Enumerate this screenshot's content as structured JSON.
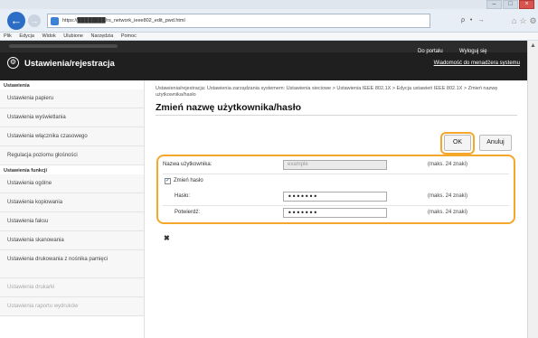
{
  "browser": {
    "url": "https://████████/rs_network_ieee802_edit_pwd.html",
    "url_tools": "ρ • →",
    "menu": [
      "Plik",
      "Edycja",
      "Widok",
      "Ulubione",
      "Narzędzia",
      "Pomoc"
    ]
  },
  "header": {
    "title": "Ustawienia/rejestracja",
    "portal_link": "Do portalu",
    "logout_link": "Wyloguj się",
    "admin_message_link": "Wiadomość do menadżera systemu"
  },
  "sidebar": {
    "section1": "Ustawienia",
    "items1": [
      "Ustawienia papieru",
      "Ustawienia wyświetlania",
      "Ustawienia włącznika czasowego",
      "Regulacja poziomu głośności"
    ],
    "section2": "Ustawienia funkcji",
    "items2": [
      "Ustawienia ogólne",
      "Ustawienia kopiowania",
      "Ustawienia faksu",
      "Ustawienia skanowania",
      "Ustawienia drukowania z nośnika pamięci",
      "Ustawienia drukarki",
      "Ustawienia raportu wydruków"
    ]
  },
  "main": {
    "breadcrumb": "Ustawienia/rejestracja: Ustawienia zarządzania systemem: Ustawienia sieciowe > Ustawienia IEEE 802.1X > Edycja ustawień IEEE 802.1X > Zmień nazwę użytkownika/hasło",
    "title": "Zmień nazwę użytkownika/hasło",
    "ok_label": "OK",
    "cancel_label": "Anuluj",
    "form": {
      "username_label": "Nazwa użytkownika:",
      "username_value": "example",
      "username_note": "(maks. 24 znaki)",
      "change_password_label": "Zmień hasło",
      "change_password_checked": true,
      "password_label": "Hasło:",
      "password_value": "•••••••",
      "password_note": "(maks. 24 znaki)",
      "confirm_label": "Potwierdź:",
      "confirm_value": "•••••••",
      "confirm_note": "(maks. 24 znaki)"
    },
    "bottom_mark": "✖"
  },
  "colors": {
    "highlight": "#f4a72a",
    "header_bg": "#1f1f1f",
    "back_button": "#2b6cc4"
  }
}
